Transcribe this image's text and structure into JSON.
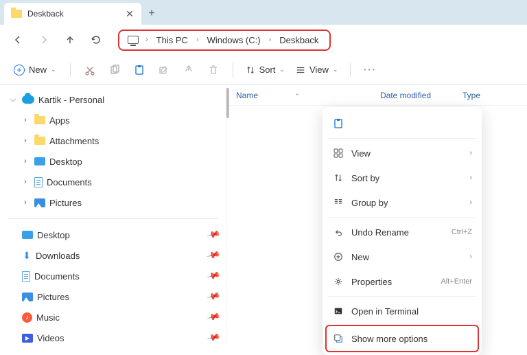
{
  "tab": {
    "title": "Deskback"
  },
  "breadcrumb": {
    "seg1": "This PC",
    "seg2": "Windows (C:)",
    "seg3": "Deskback"
  },
  "toolbar": {
    "new": "New",
    "sort": "Sort",
    "view": "View"
  },
  "columns": {
    "name": "Name",
    "date": "Date modified",
    "type": "Type"
  },
  "tree": {
    "root": "Kartik - Personal",
    "apps": "Apps",
    "attachments": "Attachments",
    "desktop": "Desktop",
    "documents": "Documents",
    "pictures": "Pictures"
  },
  "quick": {
    "desktop": "Desktop",
    "downloads": "Downloads",
    "documents": "Documents",
    "pictures": "Pictures",
    "music": "Music",
    "videos": "Videos"
  },
  "context": {
    "view": "View",
    "sort": "Sort by",
    "group": "Group by",
    "undo": "Undo Rename",
    "undo_hint": "Ctrl+Z",
    "new": "New",
    "properties": "Properties",
    "properties_hint": "Alt+Enter",
    "terminal": "Open in Terminal",
    "more": "Show more options"
  }
}
